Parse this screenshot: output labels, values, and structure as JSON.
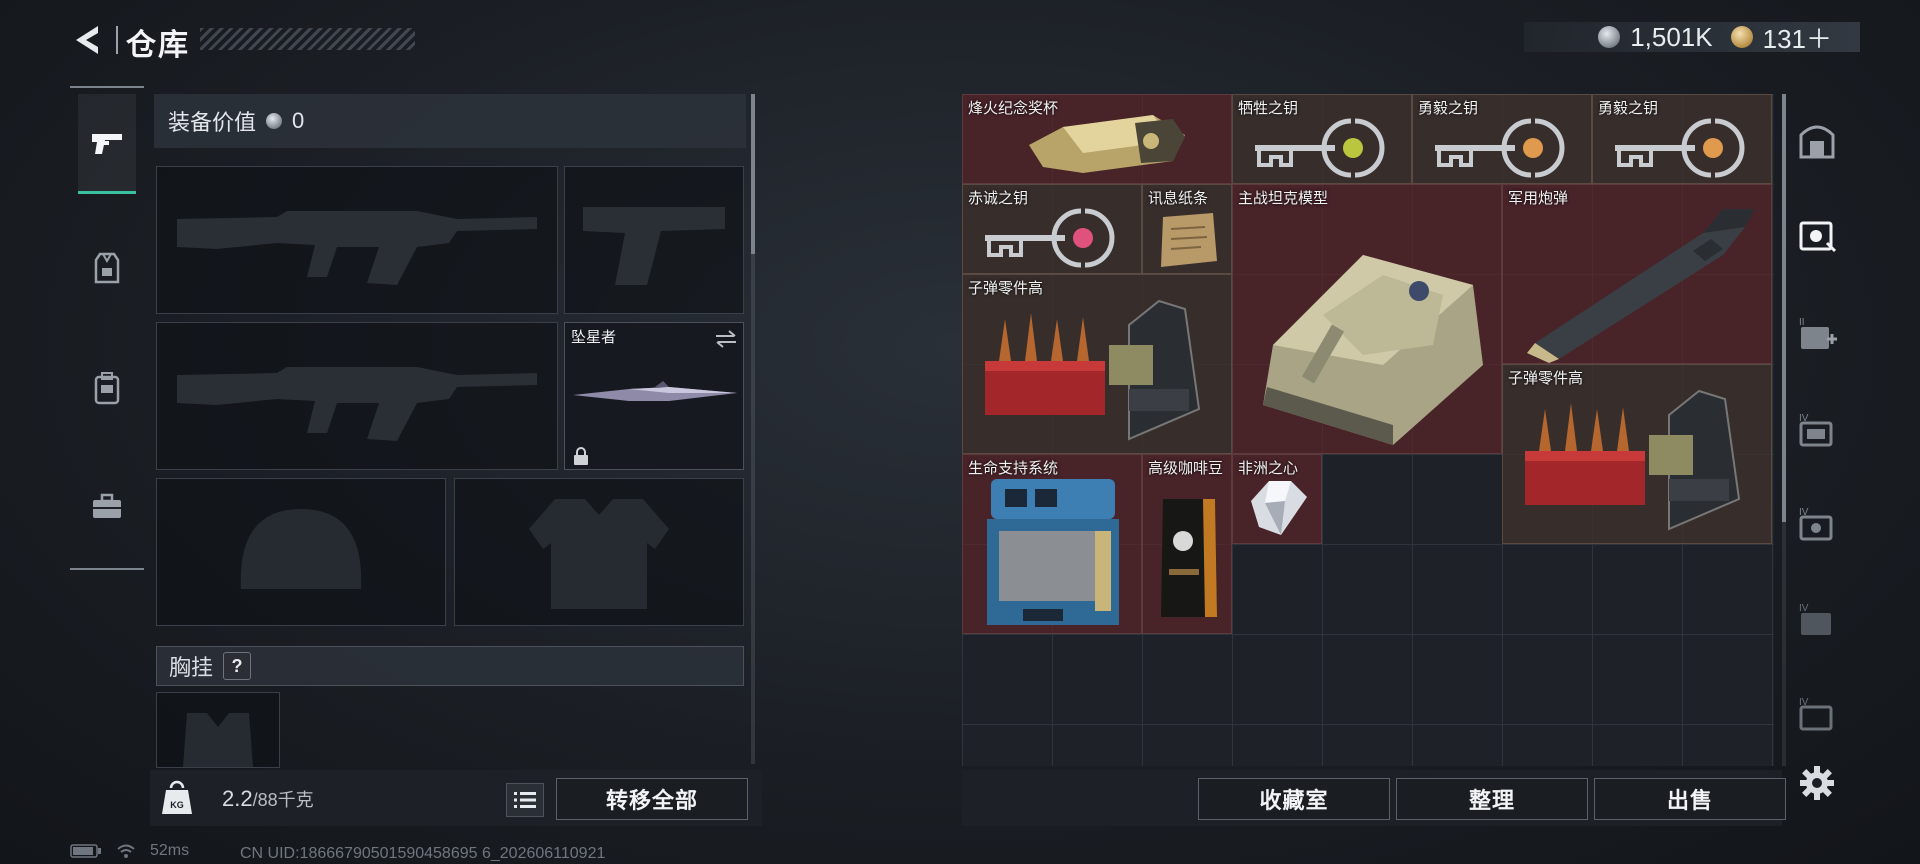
{
  "header": {
    "title": "仓库",
    "currencies": [
      {
        "icon": "silver-coin-icon",
        "value": "1,501K"
      },
      {
        "icon": "gold-coin-icon",
        "value": "131＋"
      }
    ]
  },
  "nav": {
    "tabs": [
      {
        "name": "nav-tab-weapon",
        "icon": "pistol-icon",
        "active": true
      },
      {
        "name": "nav-tab-armor",
        "icon": "armor-vest-icon",
        "active": false
      },
      {
        "name": "nav-tab-backpack",
        "icon": "backpack-icon",
        "active": false
      },
      {
        "name": "nav-tab-case",
        "icon": "briefcase-icon",
        "active": false
      }
    ]
  },
  "equipment": {
    "value_label": "装备价值",
    "value": "0",
    "melee_slot_label": "坠星者",
    "chest_rig_label": "胸挂",
    "chest_rig_help": "?",
    "weight_current": "2.2",
    "weight_capacity": "/88千克",
    "transfer_all": "转移全部"
  },
  "stash": {
    "items": [
      {
        "label": "烽火纪念奖杯",
        "icon": "trophy-icon"
      },
      {
        "label": "牺牲之钥",
        "icon": "key-icon"
      },
      {
        "label": "勇毅之钥",
        "icon": "key-icon"
      },
      {
        "label": "勇毅之钥",
        "icon": "key-icon"
      },
      {
        "label": "赤诚之钥",
        "icon": "key-icon"
      },
      {
        "label": "讯息纸条",
        "icon": "paper-note-icon"
      },
      {
        "label": "主战坦克模型",
        "icon": "tank-model-icon"
      },
      {
        "label": "军用炮弹",
        "icon": "artillery-shell-icon"
      },
      {
        "label": "子弹零件高",
        "icon": "ammo-parts-icon"
      },
      {
        "label": "子弹零件高",
        "icon": "ammo-parts-icon"
      },
      {
        "label": "生命支持系统",
        "icon": "life-support-icon"
      },
      {
        "label": "高级咖啡豆",
        "icon": "coffee-bag-icon"
      },
      {
        "label": "非洲之心",
        "icon": "diamond-icon"
      }
    ],
    "buttons": {
      "collection": "收藏室",
      "sort": "整理",
      "sell": "出售"
    }
  },
  "status": {
    "ping": "52ms",
    "uid": "CN UID:18666790501590458695 6_202606110921"
  },
  "colors": {
    "accent": "#39c2a1",
    "item_red": "#62242a",
    "item_brown": "#403228"
  }
}
